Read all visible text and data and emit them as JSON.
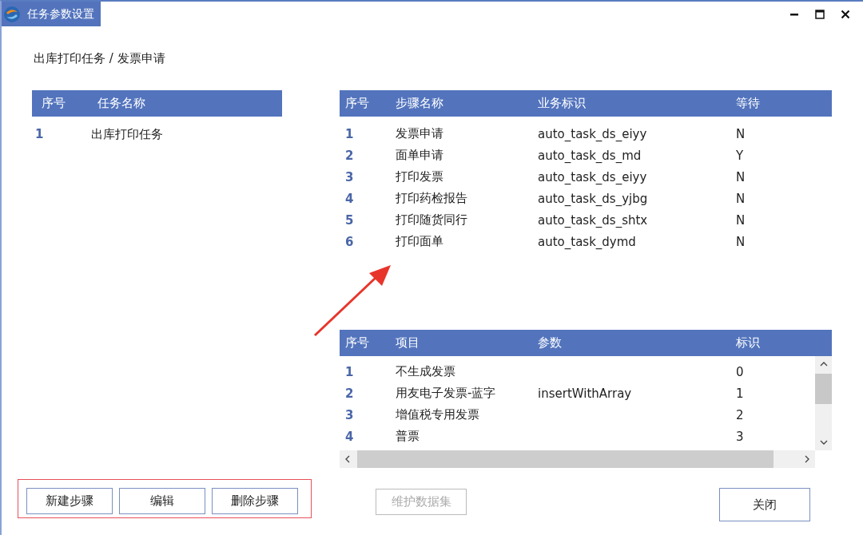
{
  "window": {
    "title": "任务参数设置"
  },
  "breadcrumb": "出库打印任务 / 发票申请",
  "tasks": {
    "columns": [
      "序号",
      "任务名称"
    ],
    "rows": [
      {
        "no": "1",
        "name": "出库打印任务",
        "selected": false
      }
    ]
  },
  "steps": {
    "columns": [
      "序号",
      "步骤名称",
      "业务标识",
      "等待"
    ],
    "rows": [
      [
        "1",
        "发票申请",
        "auto_task_ds_eiyy",
        "N"
      ],
      [
        "2",
        "面单申请",
        "auto_task_ds_md",
        "Y"
      ],
      [
        "3",
        "打印发票",
        "auto_task_ds_eiyy",
        "N"
      ],
      [
        "4",
        "打印药检报告",
        "auto_task_ds_yjbg",
        "N"
      ],
      [
        "5",
        "打印随货同行",
        "auto_task_ds_shtx",
        "N"
      ],
      [
        "6",
        "打印面单",
        "auto_task_dymd",
        "N"
      ]
    ]
  },
  "items": {
    "columns": [
      "序号",
      "项目",
      "参数",
      "标识"
    ],
    "rows": [
      [
        "1",
        "不生成发票",
        "",
        "0"
      ],
      [
        "2",
        "用友电子发票-蓝字",
        "insertWithArray",
        "1"
      ],
      [
        "3",
        "增值税专用发票",
        "",
        "2"
      ],
      [
        "4",
        "普票",
        "",
        "3"
      ]
    ]
  },
  "step_buttons": [
    {
      "label": "新建步骤",
      "disabled": false
    },
    {
      "label": "编辑",
      "disabled": false
    },
    {
      "label": "删除步骤",
      "disabled": false
    }
  ],
  "dataset_button": {
    "label": "维护数据集",
    "disabled": true
  },
  "close_button": {
    "label": "关闭",
    "disabled": false
  }
}
